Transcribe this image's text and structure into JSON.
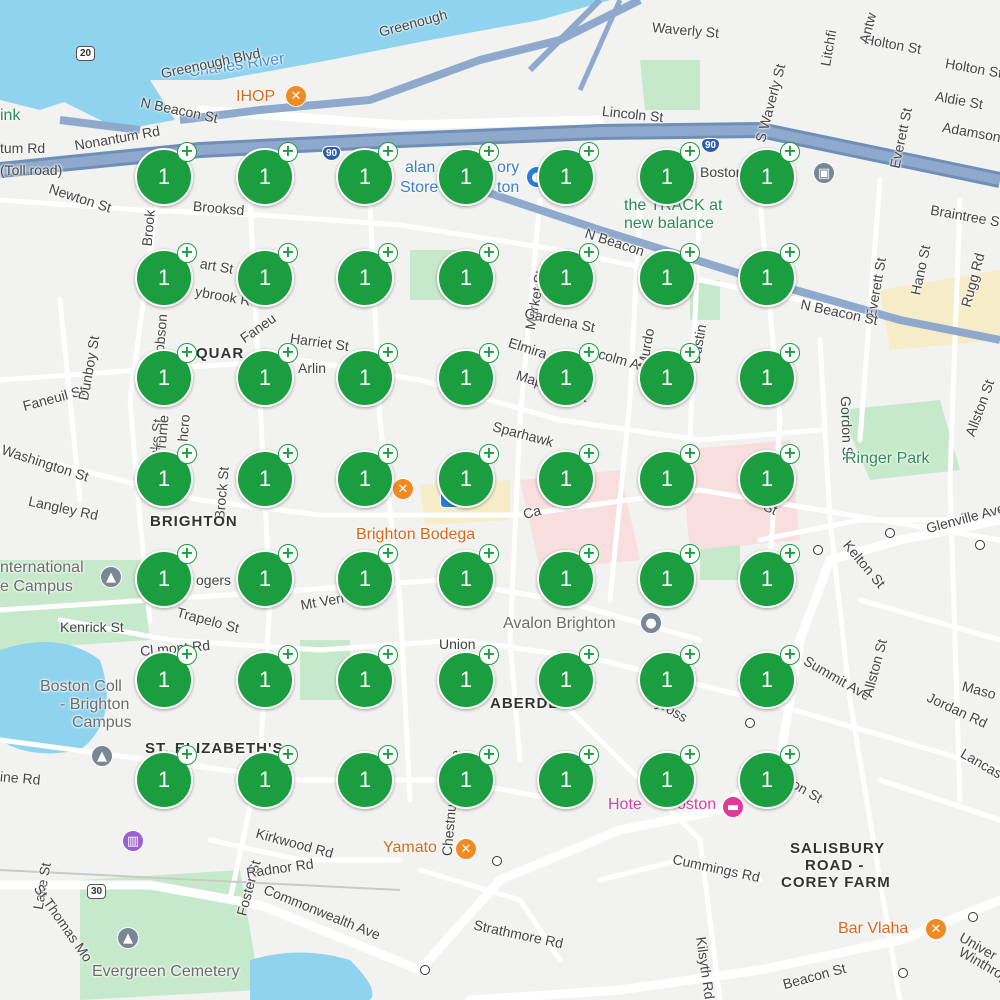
{
  "colors": {
    "cluster_fill": "#1a9e3f",
    "water": "#8fd3ee",
    "park": "#bfe6c5",
    "highway": "#7f9bbf",
    "road": "#ffffff",
    "background": "#f2f2f0"
  },
  "clusters": {
    "count_label": "1",
    "plus_label": "+",
    "columns": 7,
    "rows": 7
  },
  "labels": {
    "charles_river": "Charles River",
    "greenough_blvd": "Greenough Blvd",
    "greenough": "Greenough",
    "waverly_st": "Waverly St",
    "holton_st_1": "Holton St",
    "holton_st_2": "Holton St",
    "aldie_st": "Aldie St",
    "adamson": "Adamson",
    "litchfield": "Litchfi",
    "antw": "Antw",
    "everett_st_1": "Everett St",
    "everett_st_2": "Everett St",
    "s_waverly_st": "S Waverly St",
    "lincoln_st": "Lincoln St",
    "n_beacon_st_1": "N Beacon St",
    "n_beacon_st_2": "N Beacon St",
    "n_beacon_st_3": "N Beacon",
    "nonantum_rd": "Nonantum Rd",
    "tum_rd": "tum Rd",
    "toll_road": "(Toll road)",
    "ink": "ink",
    "newton_st": "Newton St",
    "brooksd": "Brooksd",
    "balance_store": "Store",
    "balance_1": "alan",
    "balance_2": "ory",
    "balance_3": "ton",
    "boston": "Boston",
    "track_1": "the TRACK at",
    "track_2": "new balance",
    "braintree_st": "Braintree St",
    "hano_st": "Hano St",
    "rugg_rd": "Rugg Rd",
    "market_st": "Market St",
    "gardena_st": "Gardena St",
    "elmira": "Elmira",
    "malcolm_av": "colm Av",
    "mapleton_st": "Mapleton St",
    "murdock": "Murdo",
    "dustin": "Dustin",
    "harriet_st": "Harriet St",
    "arlington": "Arlin",
    "square": "SQUAR",
    "faneuil_st_1": "Faneuil St",
    "faneuil_st_2": "Faneu",
    "art_st": "art St",
    "ybrook": "ybrook R",
    "hobson": "Hobson",
    "dunboy_st": "Dunboy St",
    "fairbanks_st": "Fairbanks St",
    "turner": "Turne",
    "church": "hcro",
    "brook_st": "Brock St",
    "brook": "Brook",
    "sparhawk": "Sparhawk",
    "gordon_st": "Gordon St",
    "allston_st_1": "Allston St",
    "allston_st_2": "Allston St",
    "ringer_park": "Ringer Park",
    "washington_st": "Washington St",
    "langley_rd": "Langley Rd",
    "brighton": "BRIGHTON",
    "brighton_bodega": "Brighton Bodega",
    "cambridge": "Ca",
    "wa_st": "W",
    "st_partial": "St",
    "kelton_st": "Kelton St",
    "glenville_ave": "Glenville Ave",
    "intl_campus_1": "nternational",
    "intl_campus_2": "e Campus",
    "rogers": "ogers",
    "mt_vernon_st": "Mt Vernon St",
    "trapelo_st": "Trapelo St",
    "kenrick_st": "Kenrick St",
    "claymont_rd": "Cl      mont Rd",
    "avalon_brighton": "Avalon Brighton",
    "union": "Union",
    "summit_ave": "Summit Ave",
    "allston_st_3": "Allston St",
    "mason": "Maso",
    "jordan_rd": "Jordan Rd",
    "boston_college_1": "Boston Coll",
    "boston_college_2": "- Brighton",
    "boston_college_3": "Campus",
    "chestnut_hill_ave": "Chestnut Hill Ave",
    "aberdeen": "ABERDE N",
    "ayross": "ayross",
    "st_elizabeths": "ST. ELIZABETH'S",
    "ine_rd": "ine Rd",
    "ington_st": "gton St",
    "lancaster_terr": "Lancaster Terrac",
    "lake_st": "Lake St",
    "foster_st": "Foster St",
    "kirkwood_rd": "Kirkwood Rd",
    "radnor_rd": "Radnor Rd",
    "yamato": "Yamato",
    "hotel_boston_1": "Hote",
    "hotel_boston_2": "oston",
    "cummings_rd": "Cummings Rd",
    "salisbury_1": "SALISBURY",
    "salisbury_2": "ROAD -",
    "salisbury_3": "COREY FARM",
    "commonwealth_ave": "Commonwealth Ave",
    "st_thomas_more": "St Thomas Mo",
    "evergreen_cemetery": "Evergreen Cemetery",
    "strathmore_rd": "Strathmore Rd",
    "kilsyth_rd": "Kilsyth Rd",
    "beacon_st": "Beacon St",
    "bar_vlaha": "Bar Vlaha",
    "winthrop_rd": "Winthrop Ro",
    "univ": "Univer",
    "ihop": "IHOP"
  },
  "shields": {
    "rt20": "20",
    "i90_a": "90",
    "i90_b": "90",
    "i90_c": "90",
    "rt30": "30"
  },
  "icons": {
    "restaurant": "restaurant-icon",
    "shopping": "shopping-bag-icon",
    "school": "school-icon",
    "hotel": "hotel-icon",
    "place": "place-icon",
    "museum": "museum-icon",
    "cemetery": "cemetery-icon",
    "train": "train-icon"
  }
}
